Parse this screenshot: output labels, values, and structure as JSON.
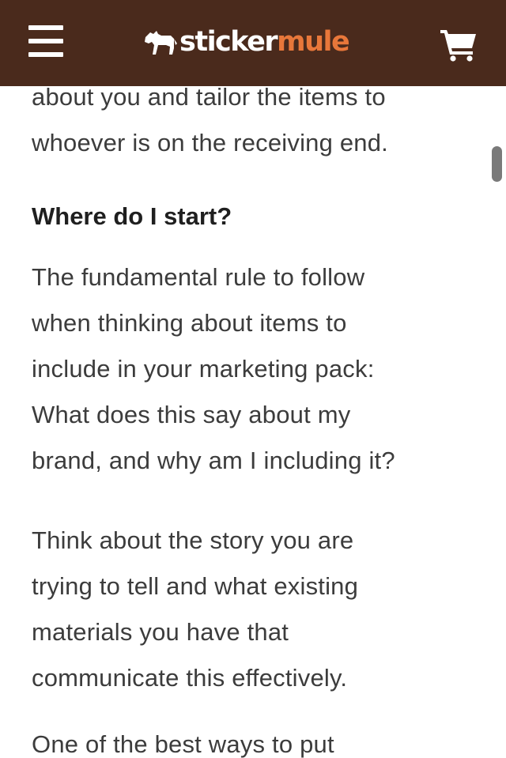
{
  "header": {
    "menu_icon": "hamburger-menu-icon",
    "logo_icon": "mule-icon",
    "logo_part1": "sticker",
    "logo_part2": "mule",
    "cart_icon": "shopping-cart-icon",
    "background_color": "#4a2a1c",
    "accent_color": "#e8773a"
  },
  "article": {
    "intro_lines": [
      "about you and tailor the items to",
      "whoever is on the receiving end."
    ],
    "heading": "Where do I start?",
    "paragraph1_lines": [
      "The fundamental rule to follow",
      "when thinking about items to",
      "include in your marketing pack:",
      "What does this say about my",
      "brand, and why am I including it?"
    ],
    "paragraph2_lines": [
      "Think about the story you are",
      "trying to tell and what existing",
      "materials you have that",
      "communicate this effectively."
    ],
    "paragraph3_lines": [
      "One of the best ways to put"
    ]
  }
}
